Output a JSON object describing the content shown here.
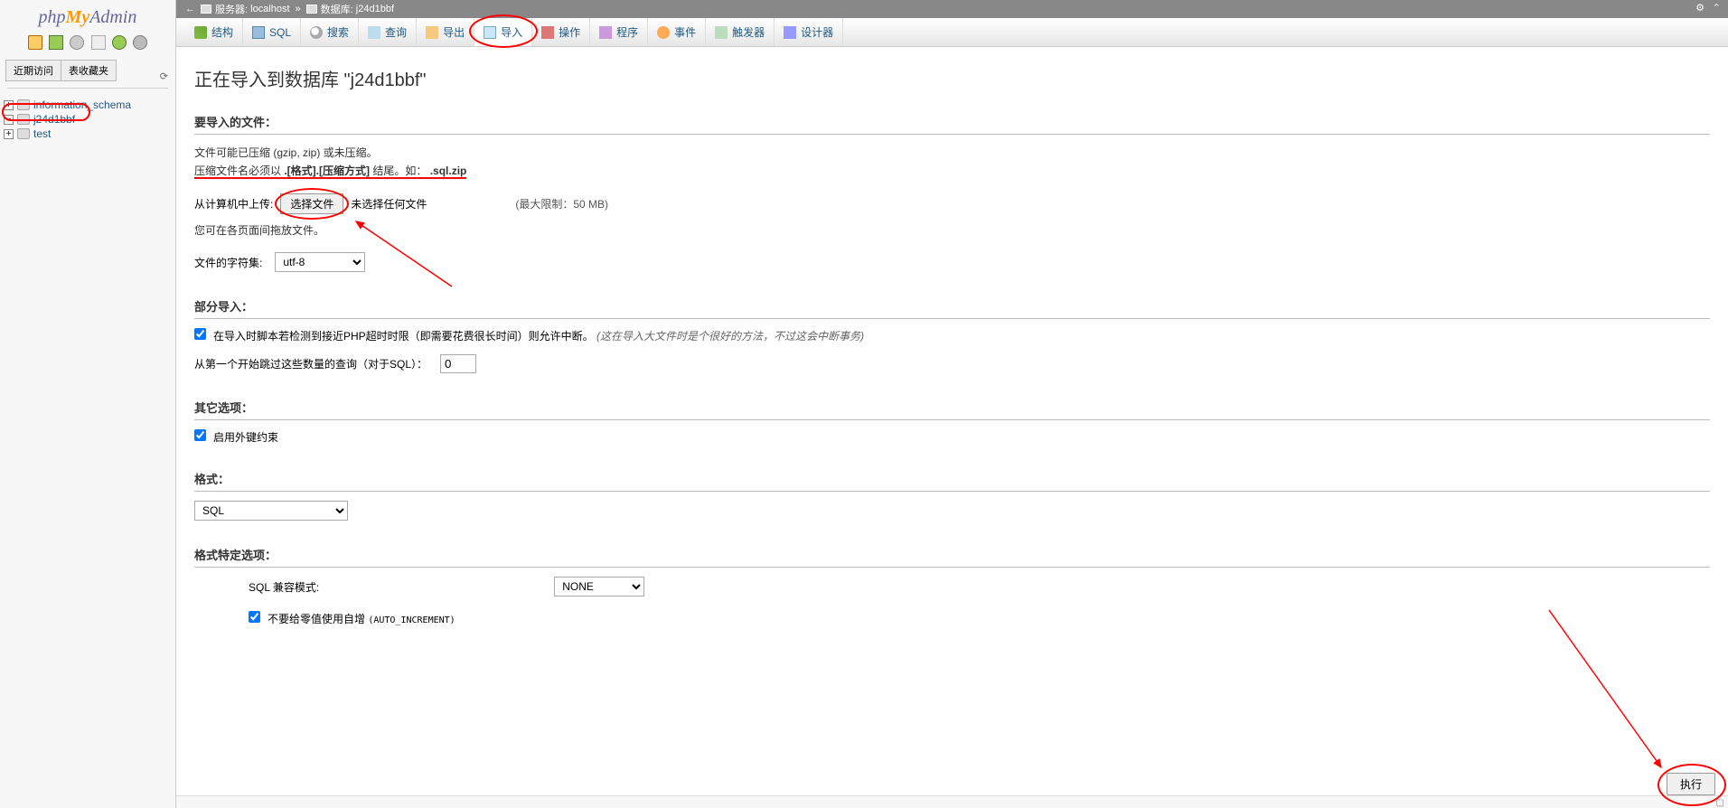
{
  "logo": {
    "php": "php",
    "my": "My",
    "admin": "Admin"
  },
  "sidebar": {
    "tabs": [
      "近期访问",
      "表收藏夹"
    ],
    "dbs": [
      {
        "name": "information_schema",
        "expand": "+"
      },
      {
        "name": "j24d1bbf",
        "expand": "−"
      },
      {
        "name": "test",
        "expand": "+"
      }
    ]
  },
  "breadcrumb": {
    "server_label": "服务器:",
    "server": "localhost",
    "db_label": "数据库:",
    "db": "j24d1bbf",
    "separator": "»"
  },
  "tabs": [
    {
      "label": "结构",
      "icon": "ico-struct"
    },
    {
      "label": "SQL",
      "icon": "ico-sql"
    },
    {
      "label": "搜索",
      "icon": "ico-search"
    },
    {
      "label": "查询",
      "icon": "ico-query"
    },
    {
      "label": "导出",
      "icon": "ico-export"
    },
    {
      "label": "导入",
      "icon": "ico-import",
      "active": true
    },
    {
      "label": "操作",
      "icon": "ico-ops"
    },
    {
      "label": "程序",
      "icon": "ico-proc"
    },
    {
      "label": "事件",
      "icon": "ico-events"
    },
    {
      "label": "触发器",
      "icon": "ico-trig"
    },
    {
      "label": "设计器",
      "icon": "ico-design"
    }
  ],
  "main": {
    "title": "正在导入到数据库 \"j24d1bbf\"",
    "import_file": {
      "legend": "要导入的文件：",
      "desc1": "文件可能已压缩 (gzip, zip) 或未压缩。",
      "desc2_pre": "压缩文件名必须以 ",
      "desc2_bold": ".[格式].[压缩方式]",
      "desc2_mid": " 结尾。如：",
      "desc2_ext": ".sql.zip",
      "from_computer": "从计算机中上传:",
      "choose_btn": "选择文件",
      "no_file": "未选择任何文件",
      "max_limit": "(最大限制：50 MB)",
      "dragdrop": "您可在各页面间拖放文件。",
      "charset_label": "文件的字符集:",
      "charset_value": "utf-8"
    },
    "partial": {
      "legend": "部分导入：",
      "allow_break": "在导入时脚本若检测到接近PHP超时时限（即需要花费很长时间）则允许中断。",
      "allow_break_note": "(这在导入大文件时是个很好的方法，不过这会中断事务)",
      "skip_label": "从第一个开始跳过这些数量的查询（对于SQL）：",
      "skip_value": "0"
    },
    "other": {
      "legend": "其它选项：",
      "fk_label": "启用外键约束"
    },
    "format": {
      "legend": "格式：",
      "value": "SQL"
    },
    "format_opts": {
      "legend": "格式特定选项：",
      "compat_label": "SQL 兼容模式:",
      "compat_value": "NONE",
      "autoincr_label": "不要给零值使用自增 ",
      "autoincr_suffix": "(AUTO_INCREMENT)"
    },
    "submit": "执行"
  }
}
